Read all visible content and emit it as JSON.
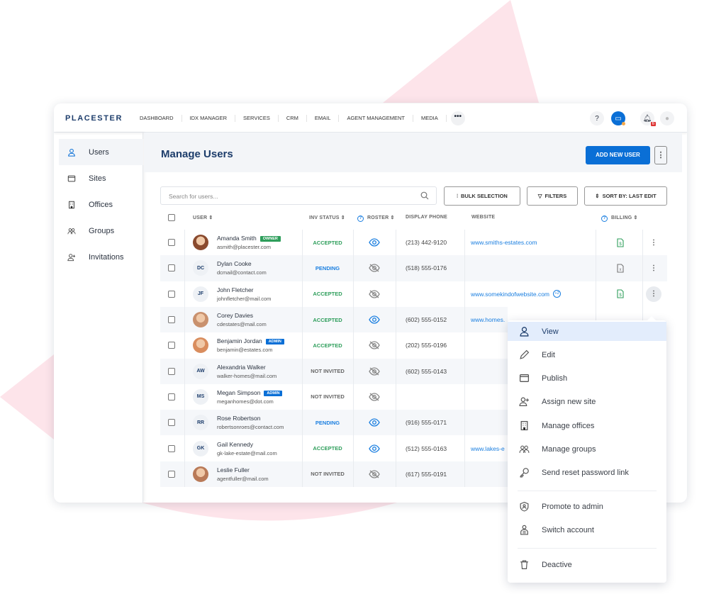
{
  "colors": {
    "accent": "#0a6fd6",
    "brand": "#1d3d6b",
    "accepted": "#2e9e5b",
    "pending": "#1b7fe0",
    "not_invited": "#666666",
    "owner_badge": "#2e9e5b",
    "admin_badge": "#0a6fd6",
    "background_shape": "#fde4ea"
  },
  "nav": {
    "logo": "PLACESTER",
    "items": [
      "DASHBOARD",
      "IDX MANAGER",
      "SERVICES",
      "CRM",
      "EMAIL",
      "AGENT MANAGEMENT",
      "MEDIA"
    ],
    "more": "•••",
    "notifications_count": "6",
    "icons": [
      "help-icon",
      "chat-icon",
      "bell-icon",
      "avatar-icon"
    ]
  },
  "sidebar": {
    "items": [
      {
        "label": "Users",
        "icon": "user-icon",
        "active": true
      },
      {
        "label": "Sites",
        "icon": "browser-icon"
      },
      {
        "label": "Offices",
        "icon": "building-icon"
      },
      {
        "label": "Groups",
        "icon": "group-icon"
      },
      {
        "label": "Invitations",
        "icon": "user-plus-icon"
      }
    ]
  },
  "header": {
    "title": "Manage Users",
    "add_button": "ADD NEW USER",
    "more": "⋮"
  },
  "toolbar": {
    "search_placeholder": "Search for users...",
    "bulk": "BULK SELECTION",
    "filters": "FILTERS",
    "sort": "SORT BY: LAST EDIT"
  },
  "table": {
    "columns": [
      "USER",
      "INV STATUS",
      "ROSTER",
      "DISPLAY PHONE",
      "WEBSITE",
      "BILLING"
    ],
    "rows": [
      {
        "name": "Amanda Smith",
        "email": "asmith@placester.com",
        "badge": "OWNER",
        "initials": "",
        "photo": true,
        "status": "ACCEPTED",
        "roster": true,
        "phone": "(213) 442-9120",
        "website": "www.smiths-estates.com",
        "extra": "",
        "billing": "paid"
      },
      {
        "name": "Dylan Cooke",
        "email": "dcmail@contact.com",
        "badge": "",
        "initials": "DC",
        "photo": false,
        "status": "PENDING",
        "roster": false,
        "phone": "(518) 555-0176",
        "website": "",
        "extra": "",
        "billing": "unpaid"
      },
      {
        "name": "John Fletcher",
        "email": "johnfletcher@mail.com",
        "badge": "",
        "initials": "JF",
        "photo": false,
        "status": "ACCEPTED",
        "roster": false,
        "phone": "",
        "website": "www.somekindofwebsite.com",
        "extra": "+2",
        "billing": "paid"
      },
      {
        "name": "Corey Davies",
        "email": "cdestates@mail.com",
        "badge": "",
        "initials": "",
        "photo": true,
        "status": "ACCEPTED",
        "roster": true,
        "phone": "(602) 555-0152",
        "website": "www.homes.",
        "extra": "",
        "billing": ""
      },
      {
        "name": "Benjamin Jordan",
        "email": "benjamin@estates.com",
        "badge": "ADMIN",
        "initials": "",
        "photo": true,
        "status": "ACCEPTED",
        "roster": false,
        "phone": "(202) 555-0196",
        "website": "",
        "extra": "",
        "billing": ""
      },
      {
        "name": "Alexandria Walker",
        "email": "walker-homes@mail.com",
        "badge": "",
        "initials": "AW",
        "photo": false,
        "status": "NOT INVITED",
        "roster": false,
        "phone": "(602) 555-0143",
        "website": "",
        "extra": "",
        "billing": ""
      },
      {
        "name": "Megan Simpson",
        "email": "meganhomes@dot.com",
        "badge": "ADMIN",
        "initials": "MS",
        "photo": false,
        "status": "NOT INVITED",
        "roster": false,
        "phone": "",
        "website": "",
        "extra": "",
        "billing": ""
      },
      {
        "name": "Rose Robertson",
        "email": "robertsonroes@contact.com",
        "badge": "",
        "initials": "RR",
        "photo": false,
        "status": "PENDING",
        "roster": true,
        "phone": "(916) 555-0171",
        "website": "",
        "extra": "",
        "billing": ""
      },
      {
        "name": "Gail Kennedy",
        "email": "gk-lake-estate@mail.com",
        "badge": "",
        "initials": "GK",
        "photo": false,
        "status": "ACCEPTED",
        "roster": true,
        "phone": "(512) 555-0163",
        "website": "www.lakes-e",
        "extra": "",
        "billing": ""
      },
      {
        "name": "Leslie Fuller",
        "email": "agentfuller@mail.com",
        "badge": "",
        "initials": "",
        "photo": true,
        "status": "NOT INVITED",
        "roster": false,
        "phone": "(617) 555-0191",
        "website": "",
        "extra": "",
        "billing": ""
      }
    ]
  },
  "menu": {
    "items": [
      {
        "label": "View",
        "icon": "user-icon"
      },
      {
        "label": "Edit",
        "icon": "pencil-icon"
      },
      {
        "label": "Publish",
        "icon": "browser-icon"
      },
      {
        "label": "Assign new site",
        "icon": "user-plus-icon"
      },
      {
        "label": "Manage offices",
        "icon": "building-icon"
      },
      {
        "label": "Manage groups",
        "icon": "group-icon"
      },
      {
        "label": "Send reset password link",
        "icon": "key-icon"
      },
      {
        "label": "Promote to admin",
        "icon": "shield-icon"
      },
      {
        "label": "Switch account",
        "icon": "switch-user-icon"
      },
      {
        "label": "Deactive",
        "icon": "trash-icon"
      }
    ]
  }
}
